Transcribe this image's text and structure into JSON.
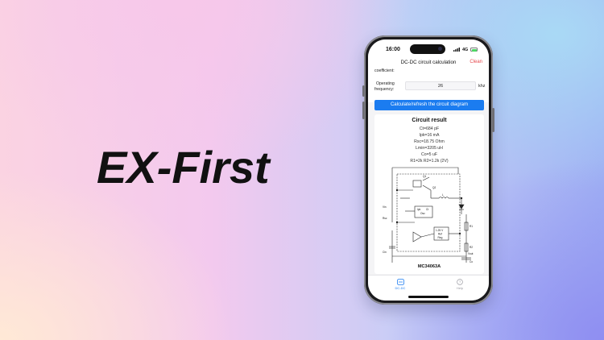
{
  "hero": {
    "title": "EX-First"
  },
  "status": {
    "time": "16:00",
    "network": "4G"
  },
  "nav": {
    "title": "DC-DC circuit calculation",
    "clean_label": "Clean"
  },
  "form": {
    "coefficient_label": "coefficient:",
    "frequency_label_line1": "Operating",
    "frequency_label_line2": "frequency:",
    "frequency_value": "26",
    "frequency_unit": "khz"
  },
  "button": {
    "calculate_label": "Calculate/refresh the circuit diagram"
  },
  "result": {
    "title": "Circuit result",
    "lines": [
      "Ct=684 pF",
      "Ipk=16 mA",
      "Rsc=18.75 Ohm",
      "Lmin=3205 uH",
      "Co=5 uF",
      "R1=2k R2=1.2k (2V)"
    ],
    "chip": "MC34063A",
    "diagram_labels": {
      "ref": "1.25 V",
      "ref2": "Ref",
      "ref3": "Reg",
      "osc": "Osc",
      "ct": "Ct",
      "ipk": "Ipk",
      "vin": "Vin",
      "vout": "Vout",
      "co": "Co",
      "r1": "R1",
      "r2": "R2",
      "cin": "Cin",
      "rsc": "Rsc",
      "l": "L",
      "q1": "Q1",
      "q2": "Q2"
    }
  },
  "tabs": [
    {
      "label": "DC-DC",
      "color": "#1b7cf0"
    },
    {
      "label": "Help",
      "color": "#9a9aa2"
    }
  ],
  "colors": {
    "accent": "#1b7cf0",
    "clean": "#e5484d"
  }
}
